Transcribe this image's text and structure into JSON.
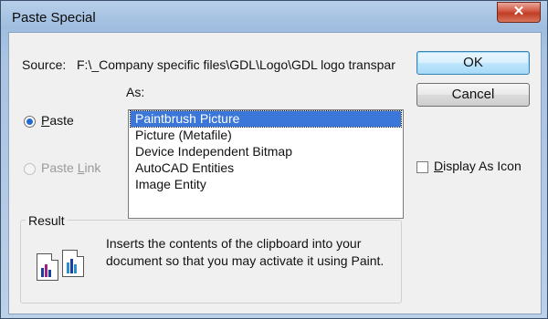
{
  "dialog": {
    "title": "Paste Special",
    "close_label": "✕"
  },
  "source": {
    "label": "Source:",
    "value": "F:\\_Company specific files\\GDL\\Logo\\GDL logo transpar"
  },
  "as_label": "As:",
  "options": {
    "paste": {
      "label": "Paste",
      "checked": true,
      "enabled": true
    },
    "paste_link": {
      "label": "Paste Link",
      "checked": false,
      "enabled": false
    }
  },
  "list": {
    "items": [
      "Paintbrush Picture",
      "Picture (Metafile)",
      "Device Independent Bitmap",
      "AutoCAD Entities",
      "Image Entity"
    ],
    "selected_index": 0
  },
  "buttons": {
    "ok": "OK",
    "cancel": "Cancel"
  },
  "display_as_icon": {
    "label": "Display As Icon",
    "checked": false
  },
  "result": {
    "label": "Result",
    "line1": "Inserts the contents of the clipboard into your",
    "line2": "document so that you may activate it using Paint."
  },
  "colors": {
    "selection": "#3a77d8",
    "radio_dot": "#1f6ad1",
    "window_frame": "#a9c3e2"
  },
  "icons": [
    "close-icon",
    "clipboard-picture-icon"
  ]
}
